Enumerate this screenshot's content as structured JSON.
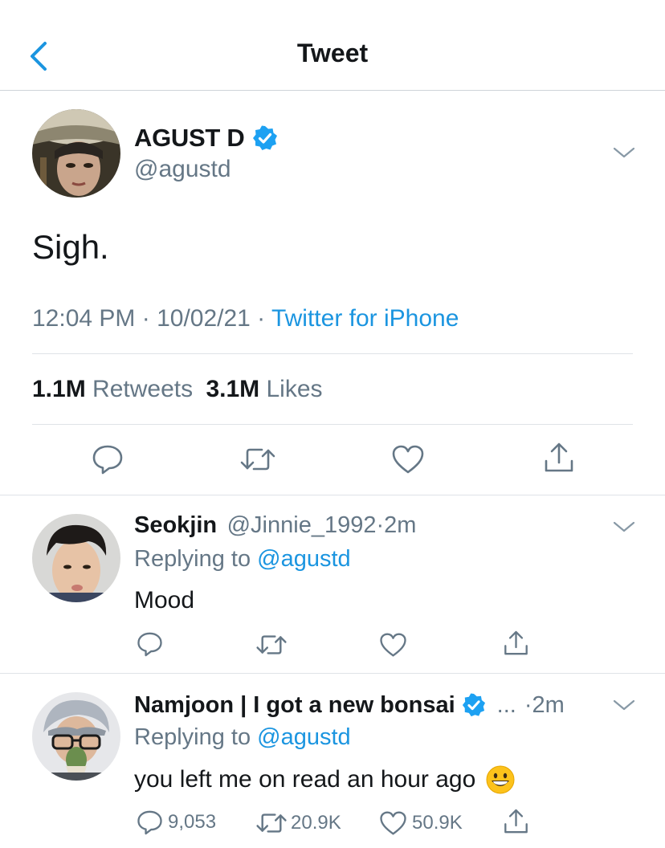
{
  "header": {
    "title": "Tweet"
  },
  "tweet": {
    "display_name": "AGUST D",
    "handle": "@agustd",
    "text": "Sigh.",
    "time": "12:04 PM · 10/02/21 · ",
    "source": "Twitter for iPhone",
    "retweets_count": "1.1M",
    "retweets_label": "Retweets",
    "likes_count": "3.1M",
    "likes_label": "Likes"
  },
  "replies": [
    {
      "display_name": "Seokjin",
      "handle": "@Jinnie_1992",
      "time": "·2m",
      "replying_prefix": "Replying to ",
      "replying_to": "@agustd",
      "text": "Mood"
    },
    {
      "display_name": "Namjoon | I got a new bonsai",
      "ellipsis": "...",
      "time": "·2m",
      "replying_prefix": "Replying to ",
      "replying_to": "@agustd",
      "text": "you left me on read an hour ago",
      "emoji": "grinning-face-emoji",
      "reply_count": "9,053",
      "retweet_count": "20.9K",
      "like_count": "50.9K"
    }
  ],
  "colors": {
    "accent": "#1b95e0",
    "verified": "#1da1f2",
    "muted": "#657786",
    "text": "#14171a"
  }
}
